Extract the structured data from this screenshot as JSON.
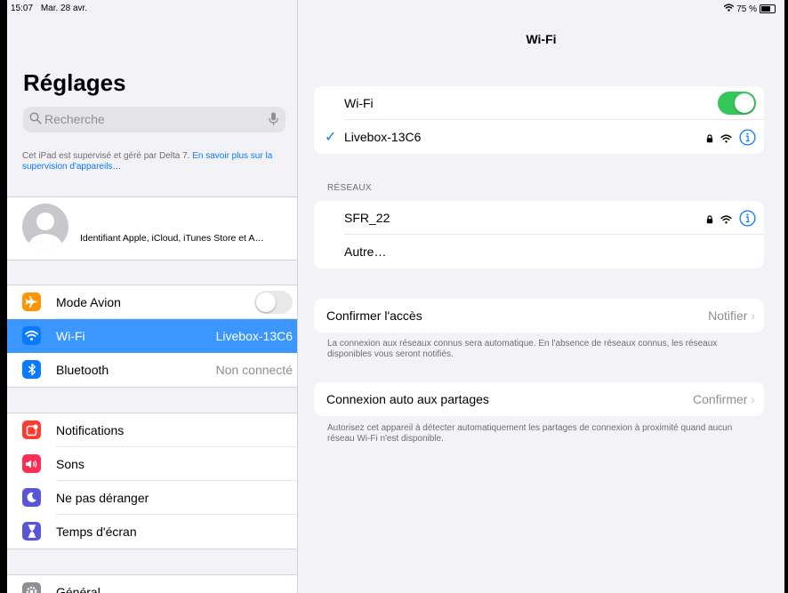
{
  "status": {
    "time": "15:07",
    "date": "Mar. 28 avr.",
    "battery": "75 %"
  },
  "sidebar": {
    "title": "Réglages",
    "search_placeholder": "Recherche",
    "supervision_text": "Cet iPad est supervisé et géré par Delta 7.",
    "supervision_link": "En savoir plus sur la supervision d'appareils…",
    "profile_label": "Identifiant Apple, iCloud, iTunes Store et A…",
    "group1": [
      {
        "label": "Mode Avion",
        "value": "",
        "icon": "airplane-icon",
        "color": "#ff9500"
      },
      {
        "label": "Wi-Fi",
        "value": "Livebox-13C6",
        "icon": "wifi-icon",
        "color": "#0a7aff"
      },
      {
        "label": "Bluetooth",
        "value": "Non connecté",
        "icon": "bluetooth-icon",
        "color": "#0a7aff"
      }
    ],
    "group2": [
      {
        "label": "Notifications",
        "icon": "notifications-icon",
        "color": "#ff3b30"
      },
      {
        "label": "Sons",
        "icon": "sounds-icon",
        "color": "#ff2d55"
      },
      {
        "label": "Ne pas déranger",
        "icon": "moon-icon",
        "color": "#5856d6"
      },
      {
        "label": "Temps d'écran",
        "icon": "hourglass-icon",
        "color": "#5856d6"
      }
    ],
    "group3": [
      {
        "label": "Général",
        "icon": "gear-icon",
        "color": "#8e8e93"
      }
    ]
  },
  "detail": {
    "title": "Wi-Fi",
    "wifi_label": "Wi-Fi",
    "connected_network": "Livebox-13C6",
    "networks_header": "RÉSEAUX",
    "networks": [
      {
        "name": "SFR_22"
      }
    ],
    "other_label": "Autre…",
    "ask_join": {
      "label": "Confirmer l'accès",
      "value": "Notifier"
    },
    "ask_join_footnote": "La connexion aux réseaux connus sera automatique. En l'absence de réseaux connus, les réseaux disponibles vous seront notifiés.",
    "hotspot": {
      "label": "Connexion auto aux partages",
      "value": "Confirmer"
    },
    "hotspot_footnote": "Autorisez cet appareil à détecter automatiquement les partages de connexion à proximité quand aucun réseau Wi-Fi n'est disponible."
  },
  "colors": {
    "accent": "#0a7aff",
    "toggle_on": "#34c759",
    "selected_row": "#3c96ff"
  }
}
